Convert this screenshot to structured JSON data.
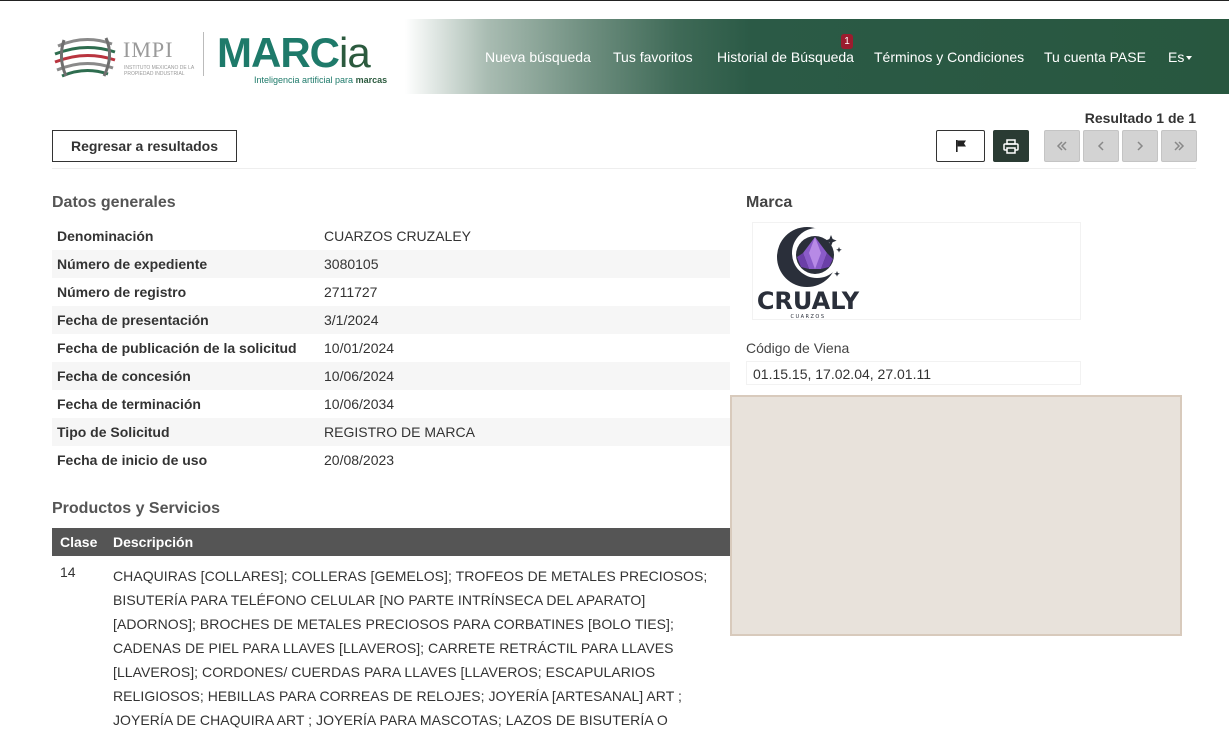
{
  "header": {
    "impi_name": "IMPI",
    "impi_subtitle": "INSTITUTO MEXICANO DE LA PROPIEDAD INDUSTRIAL",
    "app_name_main": "MARC",
    "app_name_suffix": "ia",
    "app_tagline": "Inteligencia artificial para",
    "app_tagline_bold": "marcas",
    "nav": {
      "new_search": "Nueva búsqueda",
      "favorites": "Tus favoritos",
      "history": "Historial de Búsqueda",
      "history_badge": "1",
      "terms": "Términos y Condiciones",
      "account": "Tu cuenta PASE",
      "language": "Es"
    },
    "nav_gradient_end": "#28573f",
    "badge_color": "#9b1c2e"
  },
  "toolbar": {
    "back_label": "Regresar a resultados",
    "result_counter": "Resultado 1 de 1",
    "flag_icon": "flag-icon",
    "print_icon": "print-icon",
    "pager_icons": [
      "double-chevron-left-icon",
      "chevron-left-icon",
      "chevron-right-icon",
      "double-chevron-right-icon"
    ]
  },
  "general": {
    "title": "Datos generales",
    "rows": [
      {
        "label": "Denominación",
        "value": "CUARZOS CRUZALEY"
      },
      {
        "label": "Número de expediente",
        "value": "3080105"
      },
      {
        "label": "Número de registro",
        "value": "2711727"
      },
      {
        "label": "Fecha de presentación",
        "value": "3/1/2024"
      },
      {
        "label": "Fecha de publicación de la solicitud",
        "value": "10/01/2024"
      },
      {
        "label": "Fecha de concesión",
        "value": "10/06/2024"
      },
      {
        "label": "Fecha de terminación",
        "value": "10/06/2034"
      },
      {
        "label": "Tipo de Solicitud",
        "value": "REGISTRO DE MARCA"
      },
      {
        "label": "Fecha de inicio de uso",
        "value": "20/08/2023"
      }
    ]
  },
  "products": {
    "title": "Productos y Servicios",
    "col_class": "Clase",
    "col_description": "Descripción",
    "rows": [
      {
        "class": "14",
        "description": "CHAQUIRAS [COLLARES]; COLLERAS [GEMELOS]; TROFEOS DE METALES PRECIOSOS; BISUTERÍA PARA TELÉFONO CELULAR [NO PARTE INTRÍNSECA DEL APARATO] [ADORNOS]; BROCHES DE METALES PRECIOSOS PARA CORBATINES [BOLO TIES]; CADENAS DE PIEL PARA LLAVES [LLAVEROS]; CARRETE RETRÁCTIL PARA LLAVES [LLAVEROS]; CORDONES/ CUERDAS PARA LLAVES [LLAVEROS; ESCAPULARIOS RELIGIOSOS; HEBILLAS PARA CORREAS DE RELOJES; JOYERÍA [ARTESANAL] ART ; JOYERÍA DE CHAQUIRA ART ; JOYERÍA PARA MASCOTAS; LAZOS DE BISUTERÍA O"
      }
    ]
  },
  "brand": {
    "title": "Marca",
    "logo_text": "CRUALY",
    "logo_subtext": "CUARZOS",
    "vienna_label": "Código de Viena",
    "vienna_codes": "01.15.15, 17.02.04, 27.01.11"
  }
}
